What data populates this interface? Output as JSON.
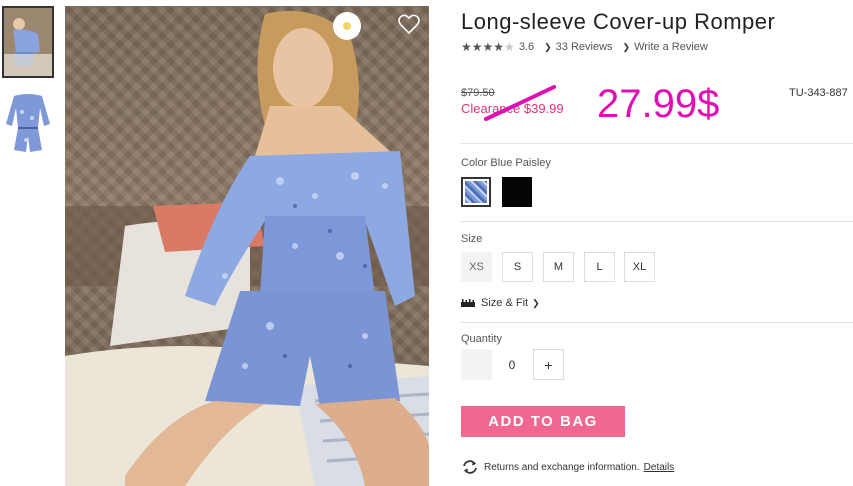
{
  "product": {
    "title": "Long-sleeve Cover-up Romper",
    "rating_value": 3.5,
    "rating": "3.6",
    "reviews_link": "33 Reviews",
    "write_review_link": "Write a Review",
    "old_price": "$79.50",
    "clearance_price": "Clearance $39.99",
    "handwritten_price": "27.99$",
    "sku": "TU-343-887"
  },
  "color": {
    "label": "Color",
    "selected": "Blue Paisley",
    "swatches": [
      {
        "name": "Blue Paisley",
        "hex": "#7b9ad6"
      },
      {
        "name": "Black",
        "hex": "#050505"
      }
    ]
  },
  "size": {
    "label": "Size",
    "options": [
      "XS",
      "S",
      "M",
      "L",
      "XL"
    ],
    "fit_link": "Size & Fit"
  },
  "quantity": {
    "label": "Quantity",
    "value": "0",
    "plus": "+"
  },
  "cta": {
    "add_to_bag": "ADD TO BAG"
  },
  "returns": {
    "text": "Returns and exchange information.",
    "link": "Details"
  },
  "colors": {
    "accent_pink": "#f0678f",
    "clearance_red": "#e0357b",
    "annotation_magenta": "#e10fb3"
  },
  "icons": {
    "favorite": "heart-icon",
    "refresh": "refresh-icon",
    "ruler": "ruler-icon"
  }
}
